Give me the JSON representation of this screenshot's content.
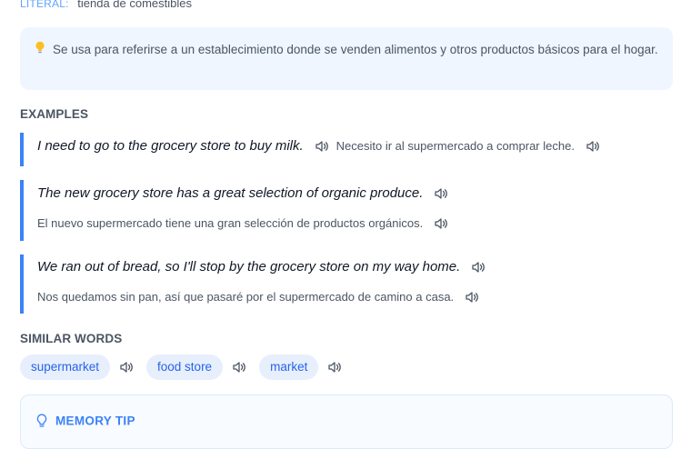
{
  "literal": {
    "label": "LITERAL:",
    "value": "tienda de comestibles"
  },
  "note": {
    "icon": "lightbulb-icon",
    "text": "Se usa para referirse a un establecimiento donde se venden alimentos y otros productos básicos para el hogar."
  },
  "examples_section": {
    "title": "EXAMPLES"
  },
  "examples": [
    {
      "en": "I need to go to the grocery store to buy milk.",
      "es": "Necesito ir al supermercado a comprar leche."
    },
    {
      "en": "The new grocery store has a great selection of organic produce.",
      "es": "El nuevo supermercado tiene una gran selección de productos orgánicos."
    },
    {
      "en": "We ran out of bread, so I'll stop by the grocery store on my way home.",
      "es": "Nos quedamos sin pan, así que pasaré por el supermercado de camino a casa."
    }
  ],
  "similar_section": {
    "title": "SIMILAR WORDS"
  },
  "similar_words": [
    "supermarket",
    "food store",
    "market"
  ],
  "memory_tip": {
    "title": "MEMORY TIP",
    "icon": "lightbulb-outline-icon"
  },
  "colors": {
    "accent": "#3b82f6",
    "note_bg": "#eff6ff",
    "chip_bg": "#e7effc",
    "chip_text": "#2563eb"
  }
}
